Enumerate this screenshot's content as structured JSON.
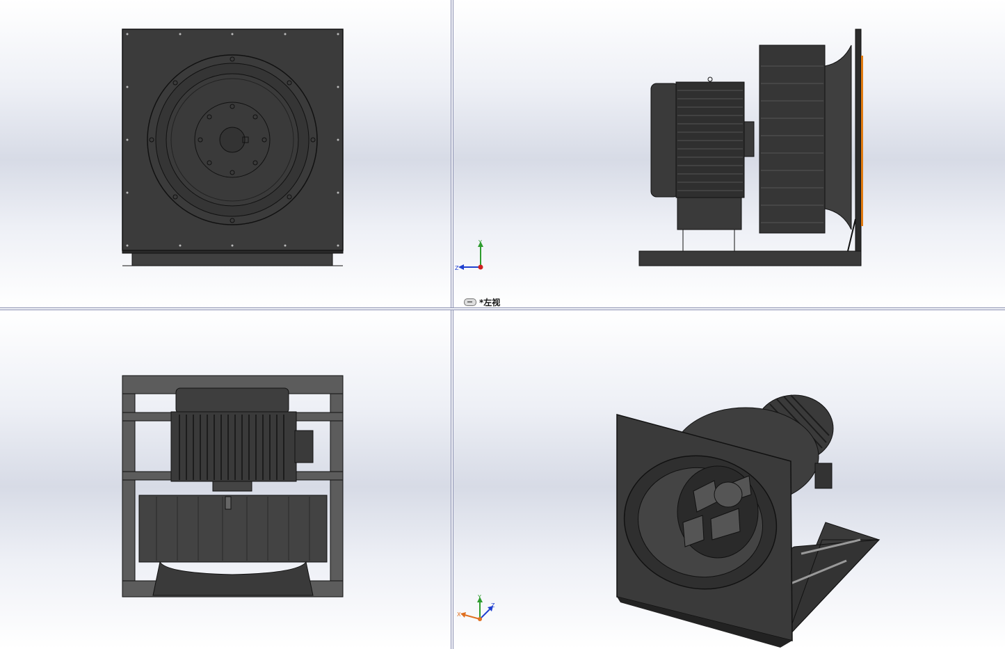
{
  "views": {
    "front": {
      "name": "front"
    },
    "left": {
      "name": "left",
      "label": "*左视"
    },
    "bottom": {
      "name": "bottom"
    },
    "iso": {
      "name": "isometric",
      "label": ""
    }
  },
  "triads": {
    "left": {
      "axes": [
        "Y",
        "Z"
      ],
      "colors": {
        "Y": "#2e9c2e",
        "Z": "#2040d0",
        "X": "#d02020"
      }
    },
    "iso": {
      "axes": [
        "Y",
        "X",
        "Z"
      ],
      "colors": {
        "Y": "#2e9c2e",
        "Z": "#2040d0",
        "X": "#e07020"
      }
    }
  },
  "icons": {
    "link": "link-icon",
    "triad": "axis-triad-icon"
  },
  "colors": {
    "model": "#3a3a3a",
    "edge": "#111111",
    "accent_orange": "#e07a10"
  }
}
